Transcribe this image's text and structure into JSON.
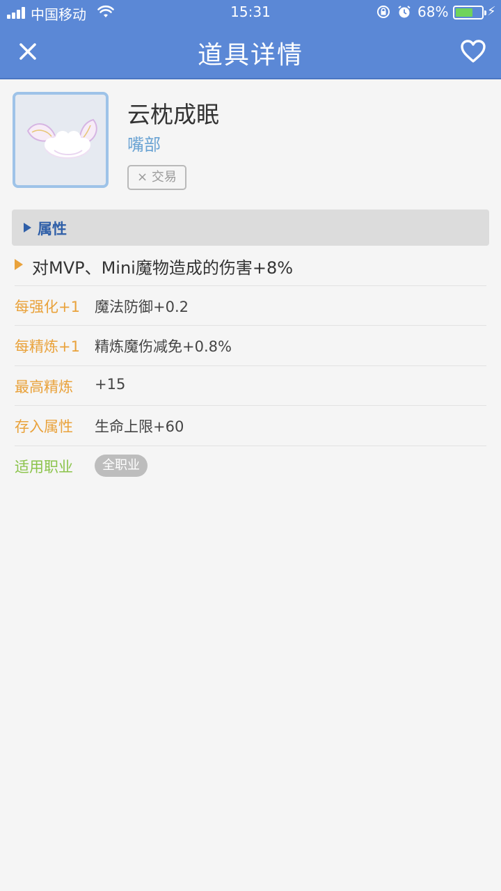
{
  "status_bar": {
    "carrier": "中国移动",
    "time": "15:31",
    "battery_percent": "68%",
    "battery_level": 0.68,
    "battery_color": "#6fd35b"
  },
  "nav": {
    "title": "道具详情",
    "close_icon": "close-icon",
    "favorite_icon": "heart-outline-icon",
    "bar_color": "#5b88d6"
  },
  "item": {
    "name": "云枕成眠",
    "slot": "嘴部",
    "trade_icon": "×",
    "trade_label": "交易",
    "image_icon": "winged-cloud-icon"
  },
  "section": {
    "label": "属性"
  },
  "effect": "对MVP、Mini魔物造成的伤害+8%",
  "attributes": [
    {
      "key": "每强化+1",
      "value": "魔法防御+0.2"
    },
    {
      "key": "每精炼+1",
      "value": "精炼魔伤减免+0.8%"
    },
    {
      "key": "最高精炼",
      "value": "+15"
    },
    {
      "key": "存入属性",
      "value": "生命上限+60"
    }
  ],
  "jobs": {
    "key": "适用职业",
    "value": "全职业"
  },
  "colors": {
    "accent_orange": "#e9a23b",
    "accent_green": "#8bc34a",
    "accent_blue": "#2f5fa8"
  }
}
